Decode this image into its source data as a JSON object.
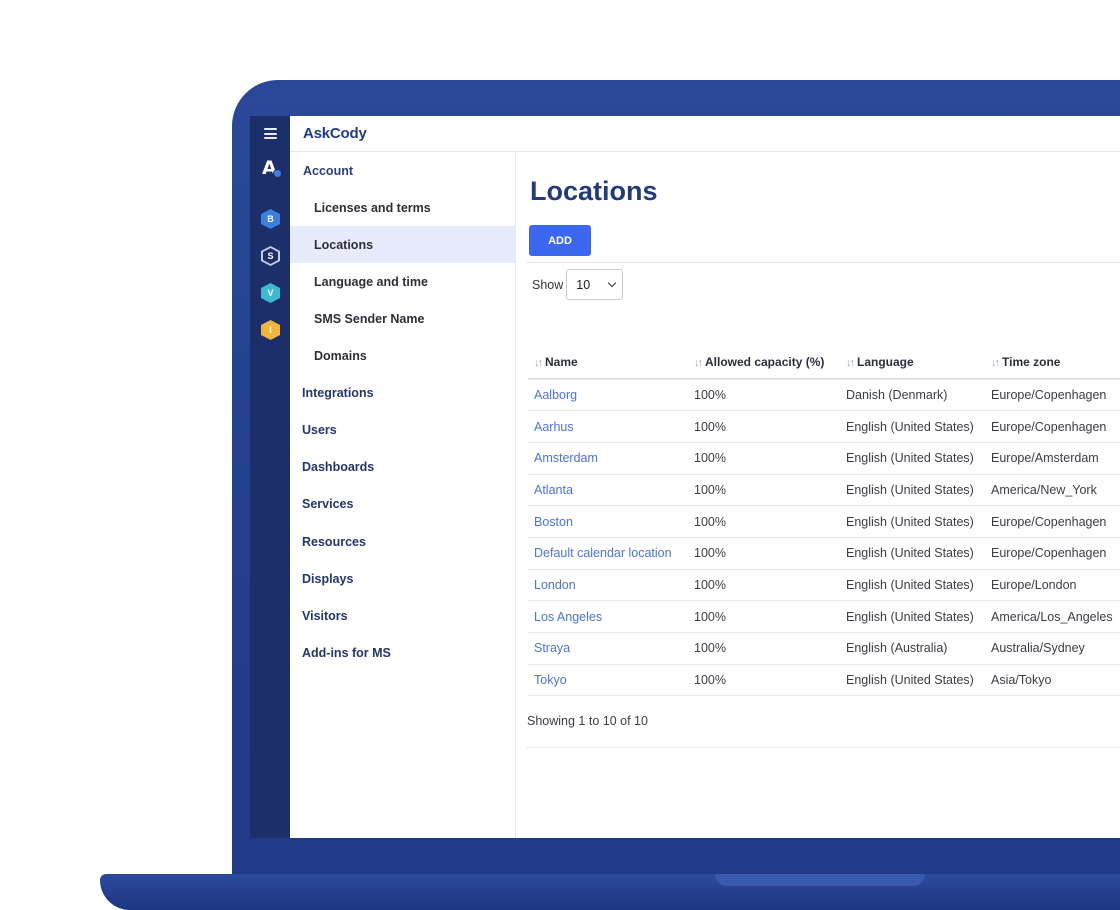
{
  "brand": "AskCody",
  "rail": {
    "logo": "A",
    "apps": [
      {
        "letter": "B",
        "color": "#3a7ee0",
        "inner": "#3a7ee0"
      },
      {
        "letter": "S",
        "color": "#c6cee6",
        "inner": "#1d2f6b"
      },
      {
        "letter": "V",
        "color": "#3dbad0",
        "inner": "#3dbad0"
      },
      {
        "letter": "I",
        "color": "#f2b53c",
        "inner": "#f2b53c"
      }
    ]
  },
  "sidebar": {
    "items": [
      {
        "label": "Account",
        "level": "top"
      },
      {
        "label": "Licenses and terms",
        "level": "sub"
      },
      {
        "label": "Locations",
        "level": "sub",
        "active": true
      },
      {
        "label": "Language and time",
        "level": "sub"
      },
      {
        "label": "SMS Sender Name",
        "level": "sub"
      },
      {
        "label": "Domains",
        "level": "sub"
      },
      {
        "label": "Integrations",
        "level": "section"
      },
      {
        "label": "Users",
        "level": "section"
      },
      {
        "label": "Dashboards",
        "level": "section"
      },
      {
        "label": "Services",
        "level": "section"
      },
      {
        "label": "Resources",
        "level": "section"
      },
      {
        "label": "Displays",
        "level": "section"
      },
      {
        "label": "Visitors",
        "level": "section"
      },
      {
        "label": "Add-ins for MS",
        "level": "section"
      }
    ]
  },
  "main": {
    "title": "Locations",
    "add_label": "ADD",
    "show_label": "Show",
    "page_size": "10",
    "columns": [
      "Name",
      "Allowed capacity (%)",
      "Language",
      "Time zone"
    ],
    "rows": [
      [
        "Aalborg",
        "100%",
        "Danish (Denmark)",
        "Europe/Copenhagen"
      ],
      [
        "Aarhus",
        "100%",
        "English (United States)",
        "Europe/Copenhagen"
      ],
      [
        "Amsterdam",
        "100%",
        "English (United States)",
        "Europe/Amsterdam"
      ],
      [
        "Atlanta",
        "100%",
        "English (United States)",
        "America/New_York"
      ],
      [
        "Boston",
        "100%",
        "English (United States)",
        "Europe/Copenhagen"
      ],
      [
        "Default calendar location",
        "100%",
        "English (United States)",
        "Europe/Copenhagen"
      ],
      [
        "London",
        "100%",
        "English (United States)",
        "Europe/London"
      ],
      [
        "Los Angeles",
        "100%",
        "English (United States)",
        "America/Los_Angeles"
      ],
      [
        "Straya",
        "100%",
        "English (Australia)",
        "Australia/Sydney"
      ],
      [
        "Tokyo",
        "100%",
        "English (United States)",
        "Asia/Tokyo"
      ]
    ],
    "footer": "Showing 1 to 10 of 10"
  }
}
